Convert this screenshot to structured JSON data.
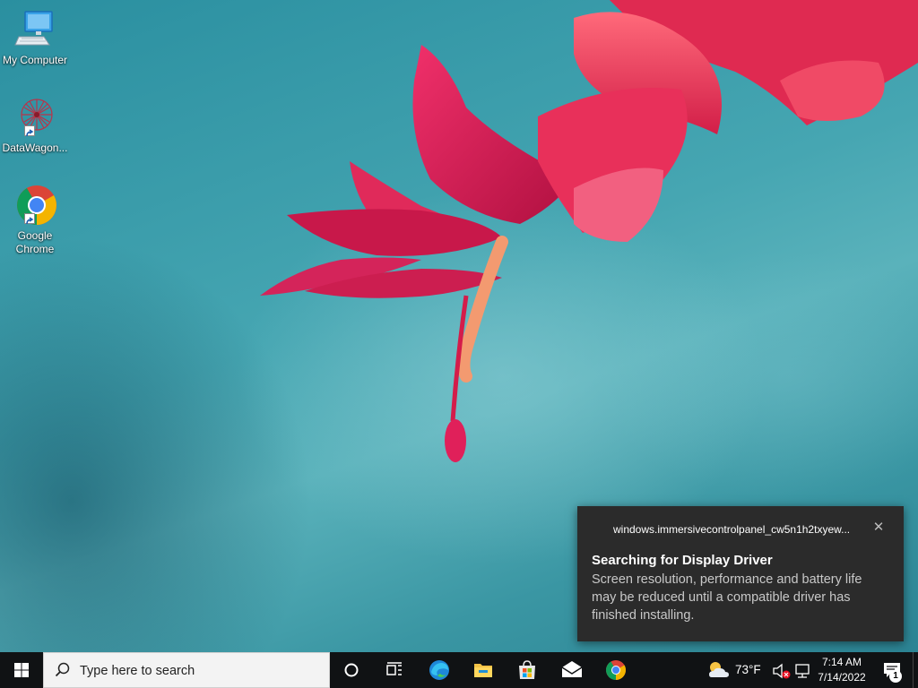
{
  "desktop": {
    "icons": [
      {
        "label": "My Computer",
        "icon": "computer-icon"
      },
      {
        "label": "DataWagon...",
        "icon": "datawagon-icon"
      },
      {
        "label": "Google Chrome",
        "icon": "chrome-icon"
      }
    ]
  },
  "toast": {
    "app_name": "windows.immersivecontrolpanel_cw5n1h2txyew...",
    "close_glyph": "✕",
    "title": "Searching for Display Driver",
    "body": "Screen resolution, performance and battery life may be reduced until a compatible driver has finished installing."
  },
  "taskbar": {
    "search_placeholder": "Type here to search",
    "pinned": [
      "cortana-icon",
      "task-view-icon",
      "edge-icon",
      "file-explorer-icon",
      "microsoft-store-icon",
      "mail-icon",
      "chrome-icon"
    ],
    "weather": {
      "temp": "73°F",
      "icon": "partly-cloudy-icon"
    },
    "clock": {
      "time": "7:14 AM",
      "date": "7/14/2022"
    },
    "notification_count": "1"
  },
  "colors": {
    "taskbar_bg": "#101214",
    "toast_bg": "#2b2b2b",
    "wallpaper_teal": "#3e97a3",
    "flower_red": "#e0204a"
  }
}
